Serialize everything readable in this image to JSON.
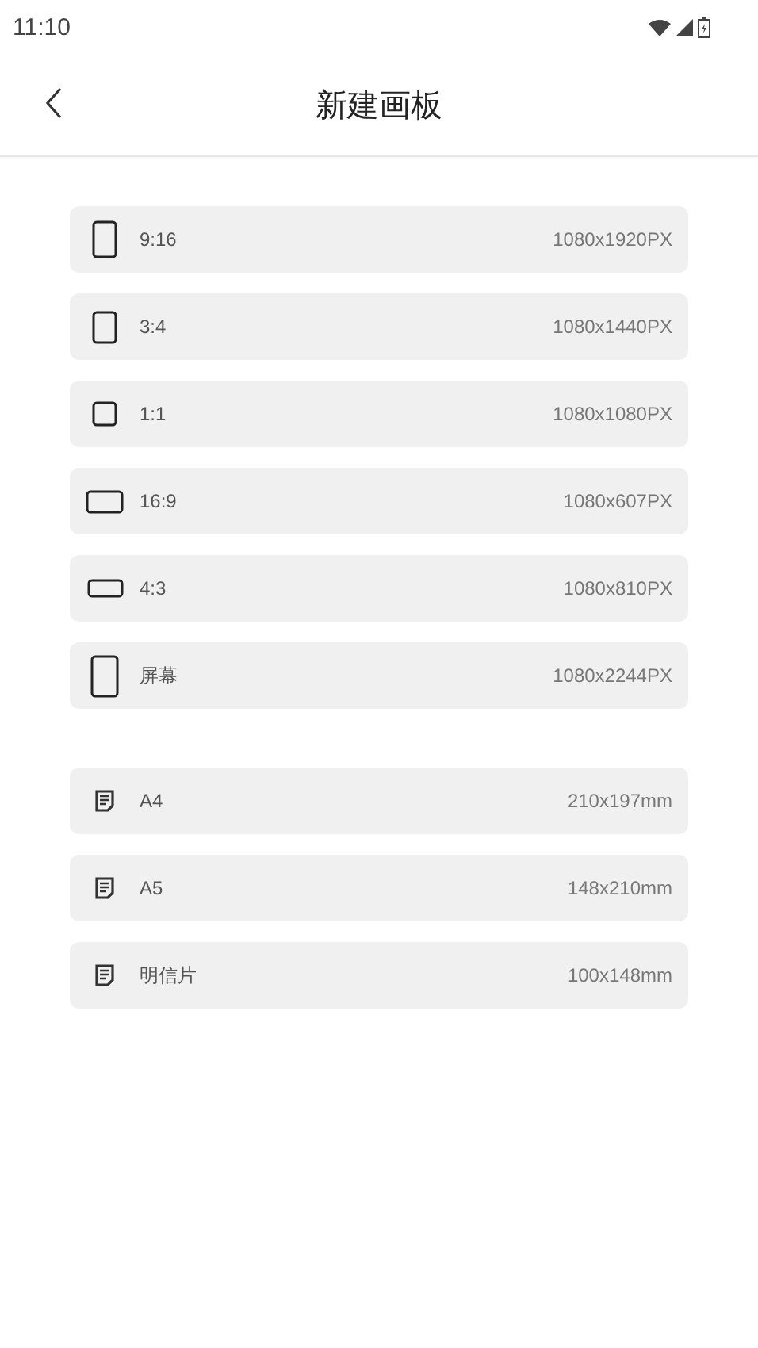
{
  "status_bar": {
    "time": "11:10"
  },
  "header": {
    "title": "新建画板"
  },
  "sections": [
    {
      "items": [
        {
          "kind": "tall",
          "label": "9:16",
          "size": "1080x1920PX"
        },
        {
          "kind": "portrait",
          "label": "3:4",
          "size": "1080x1440PX"
        },
        {
          "kind": "square",
          "label": "1:1",
          "size": "1080x1080PX"
        },
        {
          "kind": "wide",
          "label": "16:9",
          "size": "1080x607PX"
        },
        {
          "kind": "landscape",
          "label": "4:3",
          "size": "1080x810PX"
        },
        {
          "kind": "screen",
          "label": "屏幕",
          "size": "1080x2244PX"
        }
      ]
    },
    {
      "items": [
        {
          "kind": "paper",
          "label": "A4",
          "size": "210x197mm"
        },
        {
          "kind": "paper",
          "label": "A5",
          "size": "148x210mm"
        },
        {
          "kind": "paper",
          "label": "明信片",
          "size": "100x148mm"
        }
      ]
    }
  ]
}
